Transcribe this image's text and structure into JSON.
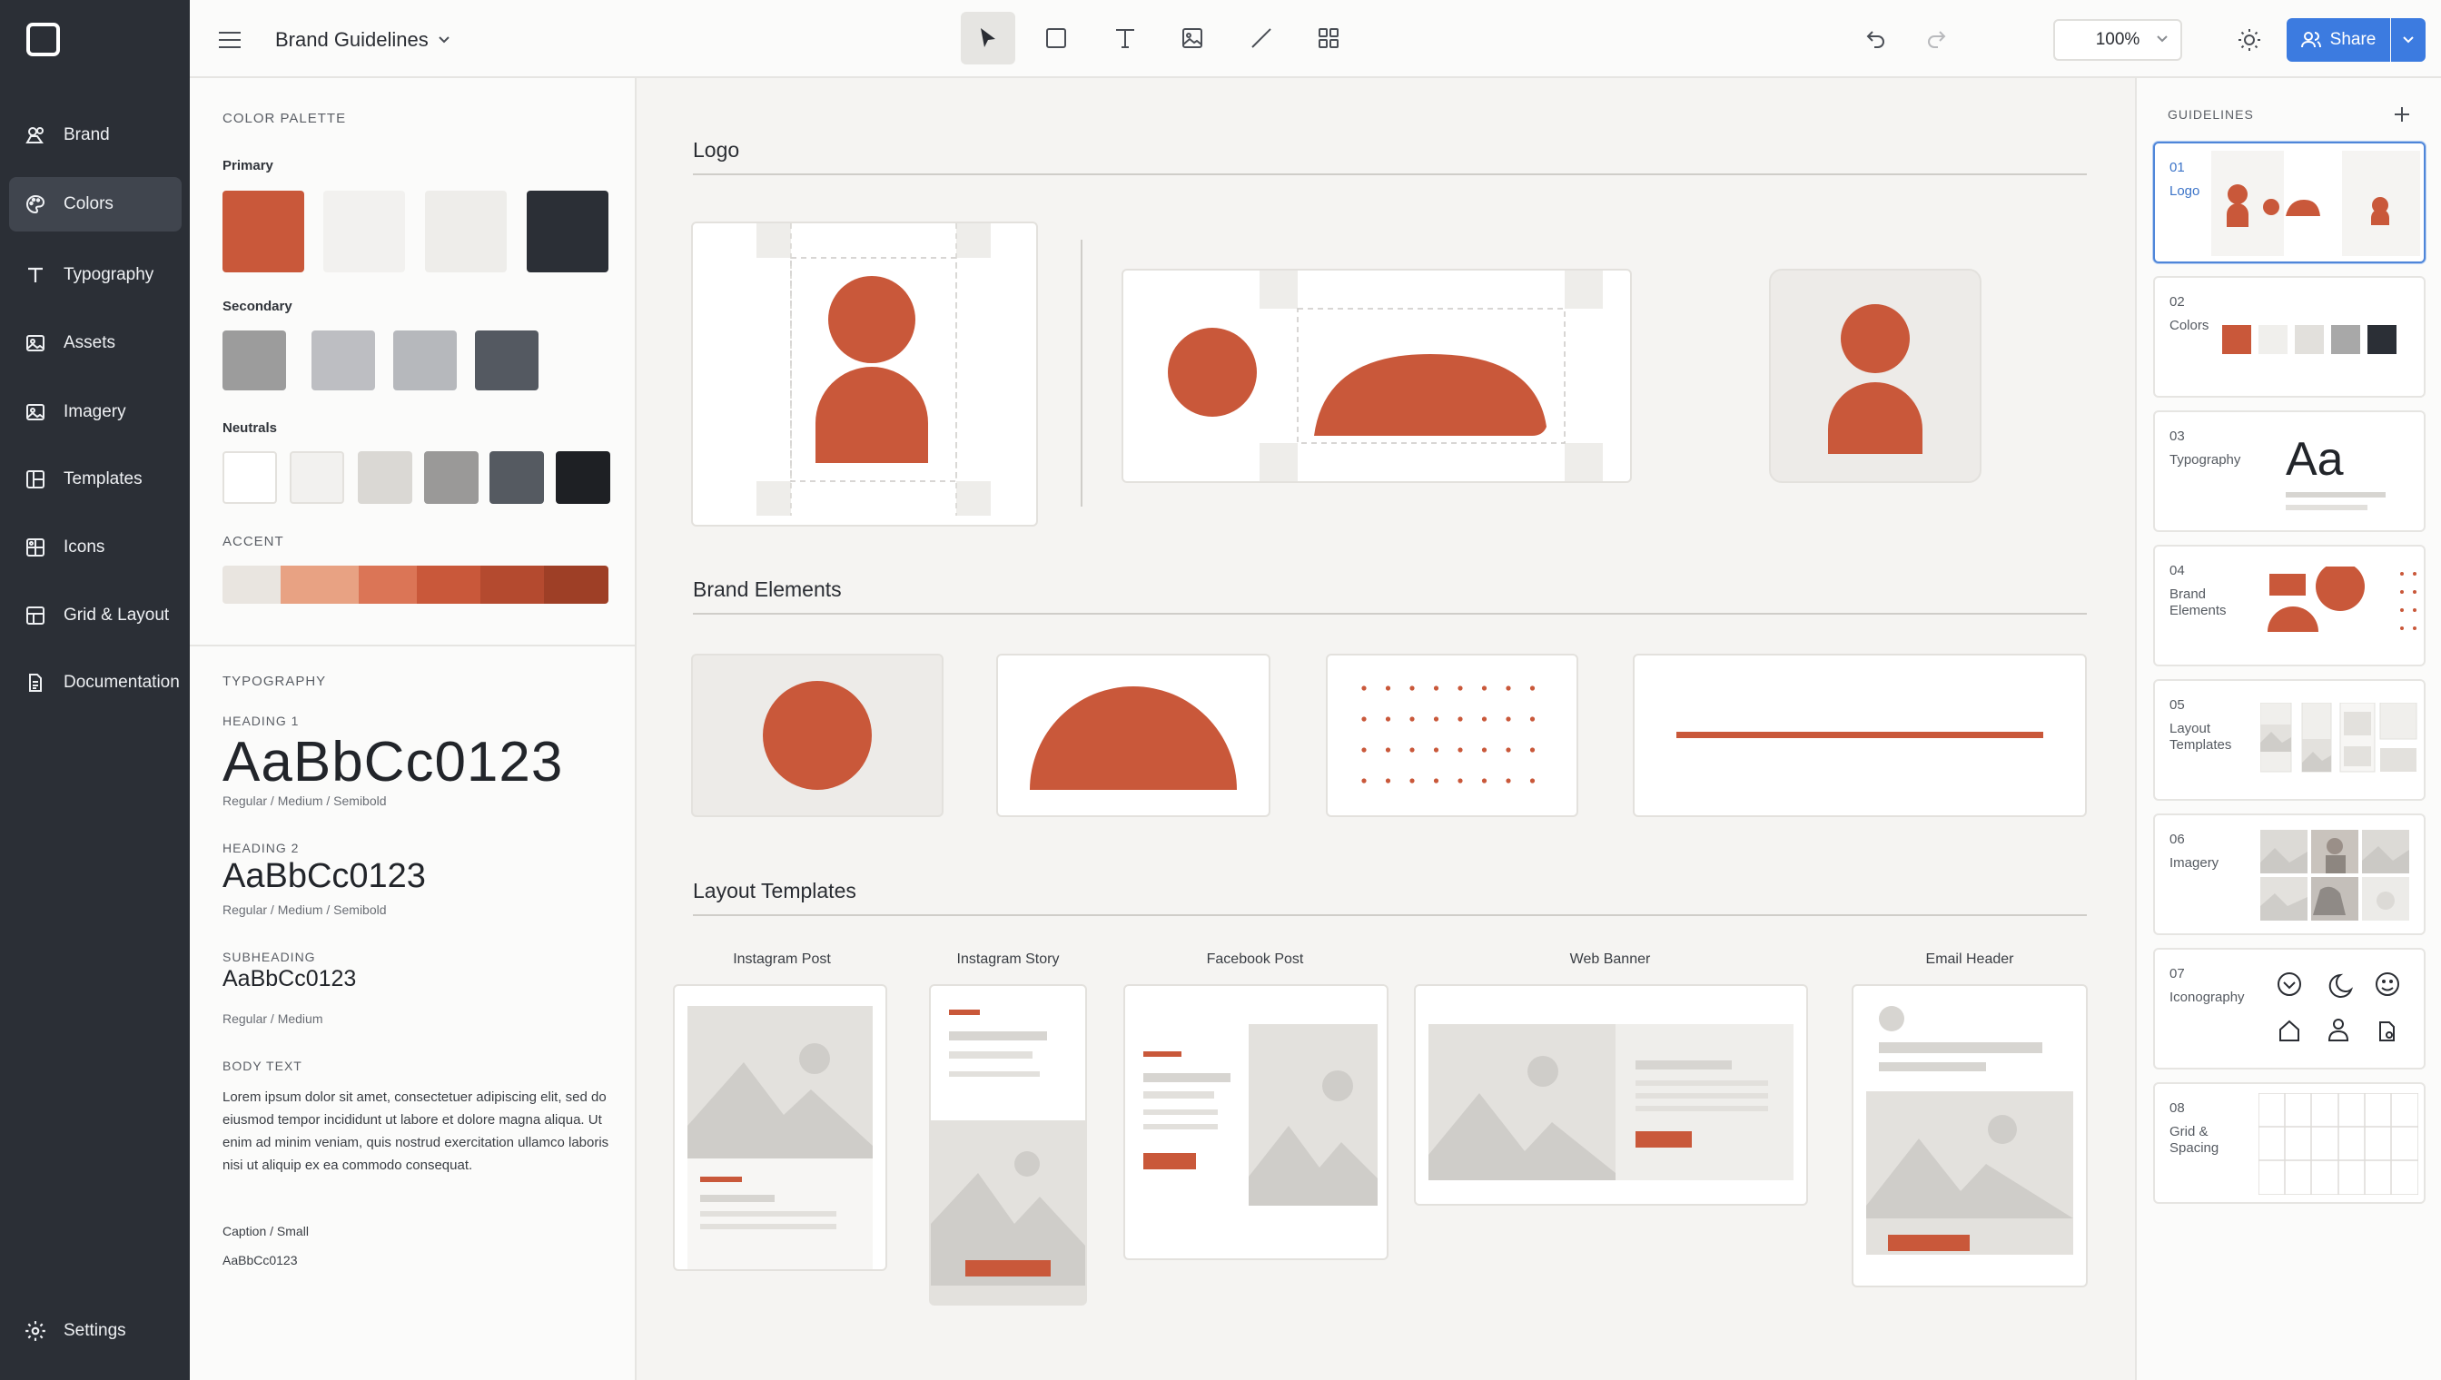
{
  "app": {
    "document_title": "Brand Guidelines"
  },
  "colors": {
    "accent_orange": "#C9583A",
    "nav_bg": "#2B2F36",
    "share_blue": "#3C7BE0"
  },
  "nav": {
    "items": [
      {
        "label": "Brand",
        "icon": "brand-icon"
      },
      {
        "label": "Colors",
        "icon": "palette-icon",
        "active": true
      },
      {
        "label": "Typography",
        "icon": "type-icon"
      },
      {
        "label": "Assets",
        "icon": "image-icon"
      },
      {
        "label": "Imagery",
        "icon": "image-icon"
      },
      {
        "label": "Templates",
        "icon": "layout-icon"
      },
      {
        "label": "Icons",
        "icon": "grid-icon"
      },
      {
        "label": "Grid & Layout",
        "icon": "layout-grid-icon"
      },
      {
        "label": "Documentation",
        "icon": "document-icon"
      }
    ],
    "settings": "Settings"
  },
  "toolbar": {
    "tools": [
      "select-tool",
      "rectangle-tool",
      "text-tool",
      "image-tool",
      "line-tool",
      "components-tool"
    ],
    "zoom": "100%",
    "share": "Share"
  },
  "palette": {
    "heading": "COLOR PALETTE",
    "primary_label": "Primary",
    "primary": [
      "#C9583A",
      "#F2F1EF",
      "#EEEDEA",
      "#2B2F36"
    ],
    "secondary_label": "Secondary",
    "secondary": [
      "#9C9C9C",
      "#BDBEC2",
      "#B6B8BC",
      "#545961"
    ],
    "neutrals_label": "Neutrals",
    "neutrals": [
      "#FFFFFF",
      "#F2F1EF",
      "#DAD8D4",
      "#9A9998",
      "#555A61",
      "#1E2024"
    ],
    "accent_label": "ACCENT",
    "accent": [
      "#E9E5E0",
      "#E8A283",
      "#DB7556",
      "#C9583A",
      "#B44A2F",
      "#9E3F26"
    ]
  },
  "typography": {
    "heading": "TYPOGRAPHY",
    "h1_label": "HEADING 1",
    "h1_sample": "AaBbCc0123",
    "h1_weights": "Regular / Medium / Semibold",
    "h2_label": "HEADING 2",
    "h2_sample": "AaBbCc0123",
    "h2_weights": "Regular / Medium / Semibold",
    "sub_label": "SUBHEADING",
    "sub_sample": "AaBbCc0123",
    "sub_weights": "Regular / Medium",
    "body_label": "BODY TEXT",
    "body_text": "Lorem ipsum dolor sit amet, consectetuer adipiscing elit, sed do eiusmod tempor incididunt ut labore et dolore magna aliqua. Ut enim ad minim veniam, quis nostrud exercitation ullamco laboris nisi ut aliquip ex ea commodo consequat.",
    "caption_label": "Caption / Small",
    "caption_sample": "AaBbCc0123"
  },
  "canvas": {
    "logo_title": "Logo",
    "elements_title": "Brand Elements",
    "templates_title": "Layout Templates",
    "templates": [
      "Instagram Post",
      "Instagram Story",
      "Facebook Post",
      "Web Banner",
      "Email Header"
    ]
  },
  "guidelines": {
    "heading": "GUIDELINES",
    "items": [
      {
        "num": "01",
        "name": "Logo",
        "active": true
      },
      {
        "num": "02",
        "name": "Colors"
      },
      {
        "num": "03",
        "name": "Typography",
        "sample": "Aa"
      },
      {
        "num": "04",
        "name": "Brand Elements"
      },
      {
        "num": "05",
        "name": "Layout Templates"
      },
      {
        "num": "06",
        "name": "Imagery"
      },
      {
        "num": "07",
        "name": "Iconography"
      },
      {
        "num": "08",
        "name": "Grid & Spacing"
      }
    ]
  }
}
